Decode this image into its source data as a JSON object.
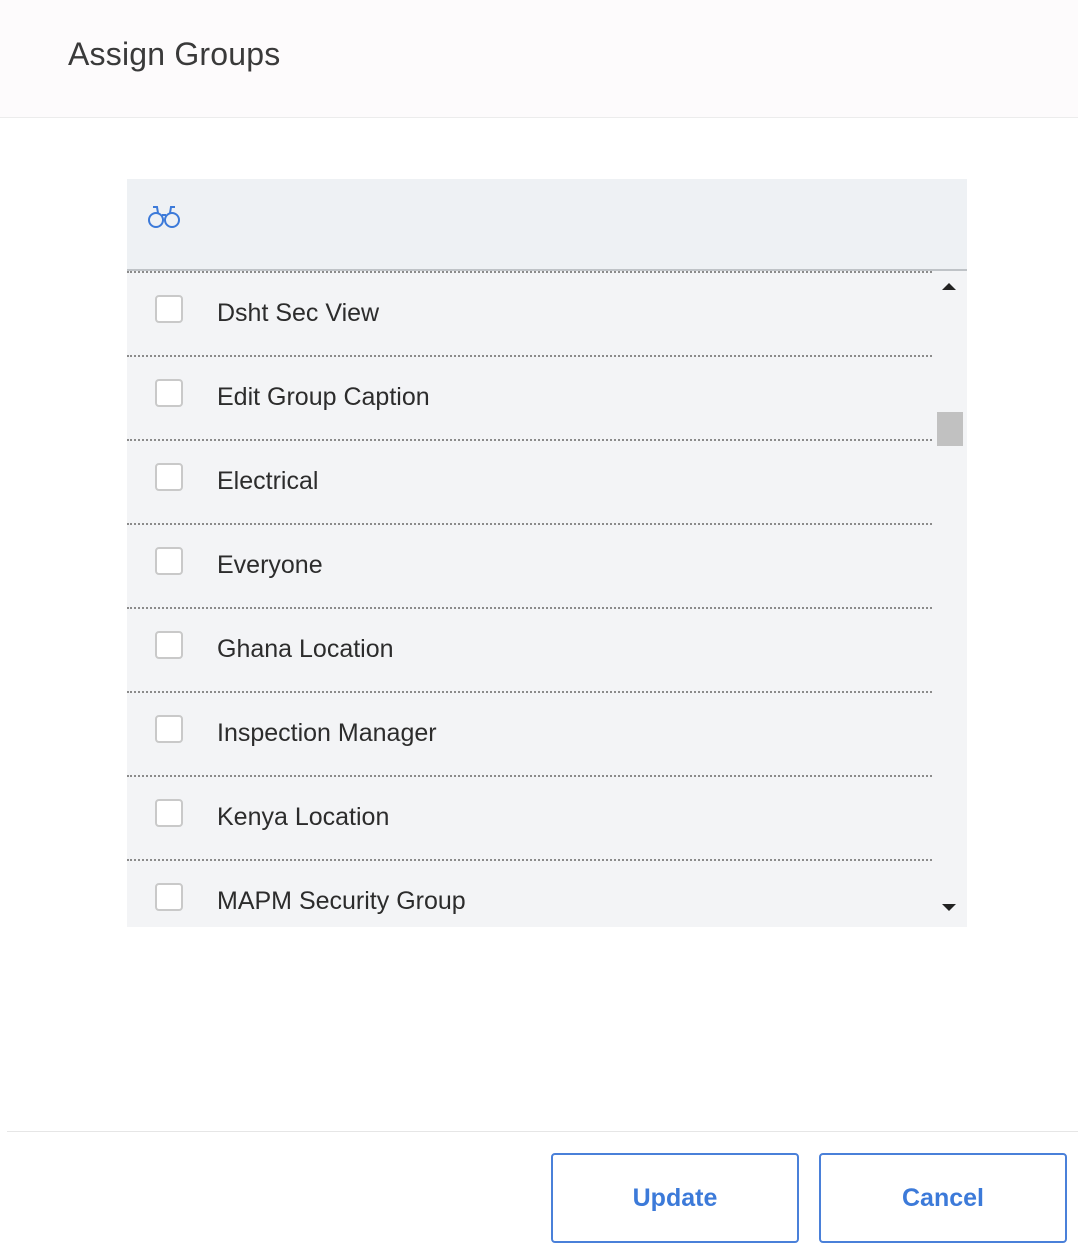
{
  "dialog": {
    "title": "Assign Groups"
  },
  "search": {
    "icon": "binoculars-icon",
    "icon_color": "#3c7ad9"
  },
  "groups": [
    {
      "label": "Dsht Sec View",
      "checked": false
    },
    {
      "label": "Edit Group Caption",
      "checked": false
    },
    {
      "label": "Electrical",
      "checked": false
    },
    {
      "label": "Everyone",
      "checked": false
    },
    {
      "label": "Ghana Location",
      "checked": false
    },
    {
      "label": "Inspection Manager",
      "checked": false
    },
    {
      "label": "Kenya Location",
      "checked": false
    },
    {
      "label": "MAPM Security Group",
      "checked": false
    }
  ],
  "footer": {
    "update_label": "Update",
    "cancel_label": "Cancel"
  },
  "colors": {
    "accent": "#3c7ad9"
  }
}
